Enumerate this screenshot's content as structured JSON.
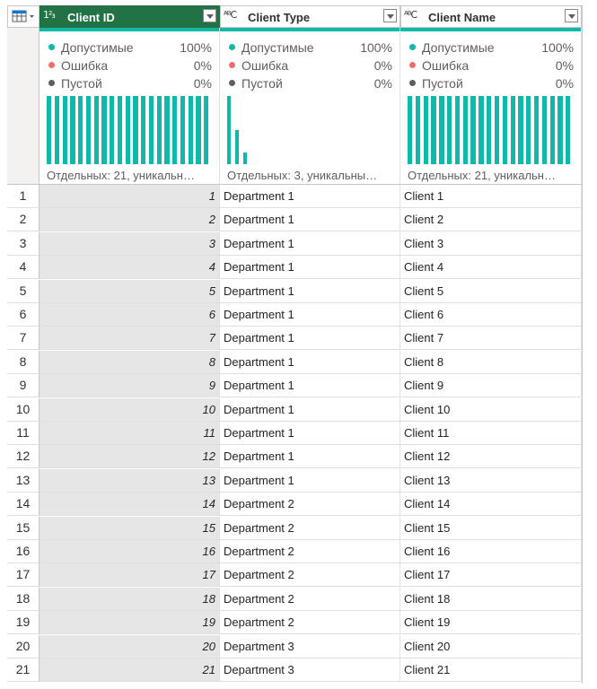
{
  "columns": [
    {
      "type_icon": "1²₃",
      "title": "Client ID",
      "selected": true,
      "distinct": "Отдельных: 21, уникальн…",
      "bars": [
        1,
        1,
        1,
        1,
        1,
        1,
        1,
        1,
        1,
        1,
        1,
        1,
        1,
        1,
        1,
        1,
        1,
        1,
        1,
        1,
        1
      ]
    },
    {
      "type_icon": "ᴬᴮC",
      "title": "Client Type",
      "selected": false,
      "distinct": "Отдельных: 3, уникальны…",
      "bars": [
        1,
        0.5,
        0.17
      ]
    },
    {
      "type_icon": "ᴬᴮC",
      "title": "Client Name",
      "selected": false,
      "distinct": "Отдельных: 21, уникальн…",
      "bars": [
        1,
        1,
        1,
        1,
        1,
        1,
        1,
        1,
        1,
        1,
        1,
        1,
        1,
        1,
        1,
        1,
        1,
        1,
        1,
        1,
        1
      ]
    }
  ],
  "quality": {
    "valid_label": "Допустимые",
    "valid_pct": "100%",
    "error_label": "Ошибка",
    "error_pct": "0%",
    "empty_label": "Пустой",
    "empty_pct": "0%",
    "colors": {
      "valid": "#0fb8a9",
      "error": "#f26d6d",
      "empty": "#605e5c"
    }
  },
  "rows": [
    {
      "n": "1",
      "id": "1",
      "type": "Department 1",
      "name": "Client 1"
    },
    {
      "n": "2",
      "id": "2",
      "type": "Department 1",
      "name": "Client 2"
    },
    {
      "n": "3",
      "id": "3",
      "type": "Department 1",
      "name": "Client 3"
    },
    {
      "n": "4",
      "id": "4",
      "type": "Department 1",
      "name": "Client 4"
    },
    {
      "n": "5",
      "id": "5",
      "type": "Department 1",
      "name": "Client 5"
    },
    {
      "n": "6",
      "id": "6",
      "type": "Department 1",
      "name": "Client 6"
    },
    {
      "n": "7",
      "id": "7",
      "type": "Department 1",
      "name": "Client 7"
    },
    {
      "n": "8",
      "id": "8",
      "type": "Department 1",
      "name": "Client 8"
    },
    {
      "n": "9",
      "id": "9",
      "type": "Department 1",
      "name": "Client 9"
    },
    {
      "n": "10",
      "id": "10",
      "type": "Department 1",
      "name": "Client 10"
    },
    {
      "n": "11",
      "id": "11",
      "type": "Department 1",
      "name": "Client 11"
    },
    {
      "n": "12",
      "id": "12",
      "type": "Department 1",
      "name": "Client 12"
    },
    {
      "n": "13",
      "id": "13",
      "type": "Department 1",
      "name": "Client 13"
    },
    {
      "n": "14",
      "id": "14",
      "type": "Department 2",
      "name": "Client 14"
    },
    {
      "n": "15",
      "id": "15",
      "type": "Department 2",
      "name": "Client 15"
    },
    {
      "n": "16",
      "id": "16",
      "type": "Department 2",
      "name": "Client 16"
    },
    {
      "n": "17",
      "id": "17",
      "type": "Department 2",
      "name": "Client 17"
    },
    {
      "n": "18",
      "id": "18",
      "type": "Department 2",
      "name": "Client 18"
    },
    {
      "n": "19",
      "id": "19",
      "type": "Department 2",
      "name": "Client 19"
    },
    {
      "n": "20",
      "id": "20",
      "type": "Department 3",
      "name": "Client 20"
    },
    {
      "n": "21",
      "id": "21",
      "type": "Department 3",
      "name": "Client 21"
    }
  ]
}
